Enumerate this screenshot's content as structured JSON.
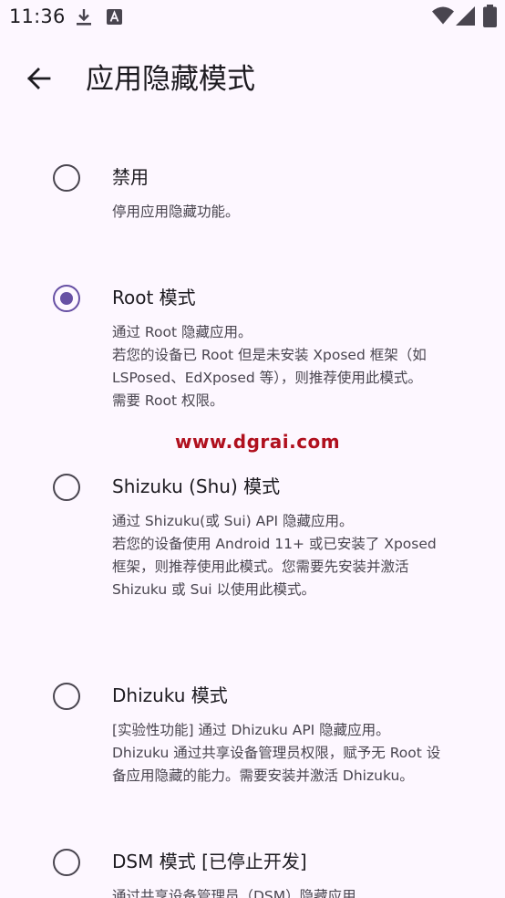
{
  "status_bar": {
    "time": "11:36",
    "icons": [
      "download-icon",
      "font-a-icon",
      "wifi-icon",
      "signal-icon",
      "battery-icon"
    ]
  },
  "app_bar": {
    "back_icon": "arrow-left-icon",
    "title": "应用隐藏模式"
  },
  "watermark": "www.dgrai.com",
  "options": [
    {
      "title": "禁用",
      "selected": false,
      "desc_lines": [
        "停用应用隐藏功能。"
      ]
    },
    {
      "title": "Root 模式",
      "selected": true,
      "desc_lines": [
        "通过 Root 隐藏应用。",
        "若您的设备已 Root 但是未安装 Xposed 框架（如",
        "LSPosed、EdXposed 等），则推荐使用此模式。",
        "需要 Root 权限。"
      ]
    },
    {
      "title": "Shizuku (Shu) 模式",
      "selected": false,
      "desc_lines": [
        "通过 Shizuku(或 Sui) API 隐藏应用。",
        "若您的设备使用 Android 11+ 或已安装了 Xposed",
        "框架，则推荐使用此模式。您需要先安装并激活",
        "Shizuku 或 Sui 以使用此模式。"
      ]
    },
    {
      "title": "Dhizuku 模式",
      "selected": false,
      "desc_lines": [
        "[实验性功能] 通过 Dhizuku API 隐藏应用。",
        "Dhizuku 通过共享设备管理员权限，赋予无 Root 设",
        "备应用隐藏的能力。需要安装并激活 Dhizuku。"
      ]
    },
    {
      "title": "DSM 模式 [已停止开发]",
      "selected": false,
      "desc_lines": [
        "通过共享设备管理员（DSM）隐藏应用"
      ]
    }
  ],
  "colors": {
    "background": "#fdf7ff",
    "accent": "#6750a4",
    "text_primary": "#1d1b20",
    "text_secondary": "#49454f",
    "watermark": "#b0101e"
  }
}
